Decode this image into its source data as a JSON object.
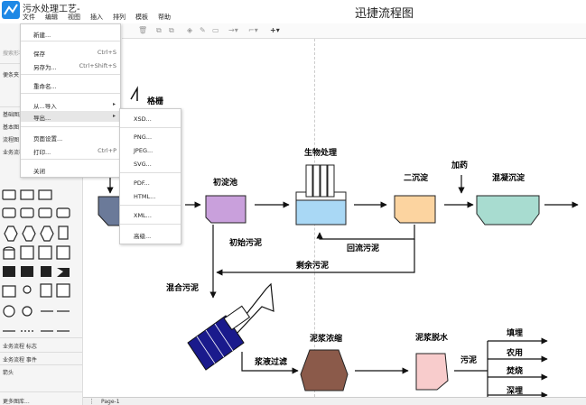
{
  "app": {
    "doc_title": "污水处理工艺-",
    "app_title": "迅捷流程图"
  },
  "menubar": [
    "文件",
    "编辑",
    "视图",
    "插入",
    "排列",
    "模板",
    "帮助"
  ],
  "file_menu": {
    "items": [
      {
        "label": "新建...",
        "shortcut": ""
      },
      {
        "label": "保存",
        "shortcut": "Ctrl+S"
      },
      {
        "label": "另存为...",
        "shortcut": "Ctrl+Shift+S"
      },
      {
        "label": "重命名...",
        "shortcut": ""
      },
      {
        "label": "从...导入",
        "shortcut": ""
      },
      {
        "label": "导出...",
        "shortcut": ""
      },
      {
        "label": "页面设置...",
        "shortcut": ""
      },
      {
        "label": "打印...",
        "shortcut": "Ctrl+P"
      },
      {
        "label": "关闭",
        "shortcut": ""
      }
    ]
  },
  "export_submenu": {
    "items": [
      "XSD...",
      "PNG...",
      "JPEG...",
      "SVG...",
      "PDF...",
      "HTML...",
      "XML...",
      "高级..."
    ]
  },
  "sidebar": {
    "search_placeholder": "搜索形状",
    "sections": [
      "便条夹",
      "基础图形",
      "基本图",
      "流程图",
      "业务流程"
    ],
    "footer_sections": [
      "业务流程 标志",
      "业务流程 事件",
      "箭头"
    ],
    "more": "更多图库..."
  },
  "bottombar": {
    "page_tab": "Page-1"
  },
  "diagram": {
    "labels": {
      "grille": "格栅",
      "primary_clarifier": "初淀池",
      "bio_treatment": "生物处理",
      "secondary_clarifier": "二沉淀",
      "dosing": "加药",
      "coag_settling": "混凝沉淀",
      "primary_sludge": "初始污泥",
      "return_sludge": "回流污泥",
      "excess_sludge": "剩余污泥",
      "mixed_sludge": "混合污泥",
      "sludge_thickening": "泥浆浓缩",
      "sludge_dewatering": "泥浆脱水",
      "filtrate": "浆液过滤",
      "sludge_out": "污泥",
      "landfill": "填埋",
      "agriculture": "农用",
      "incineration": "焚烧",
      "dumping": "深埋"
    },
    "colors": {
      "primary_clarifier": "#c9a0dc",
      "bio_tank": "#a9d8f5",
      "secondary_clarifier": "#fcd4a0",
      "coag_settling": "#a8dcd0",
      "thickener": "#8b5a4a",
      "dewatering": "#f8cccc",
      "press": "#1a1a8c"
    }
  }
}
